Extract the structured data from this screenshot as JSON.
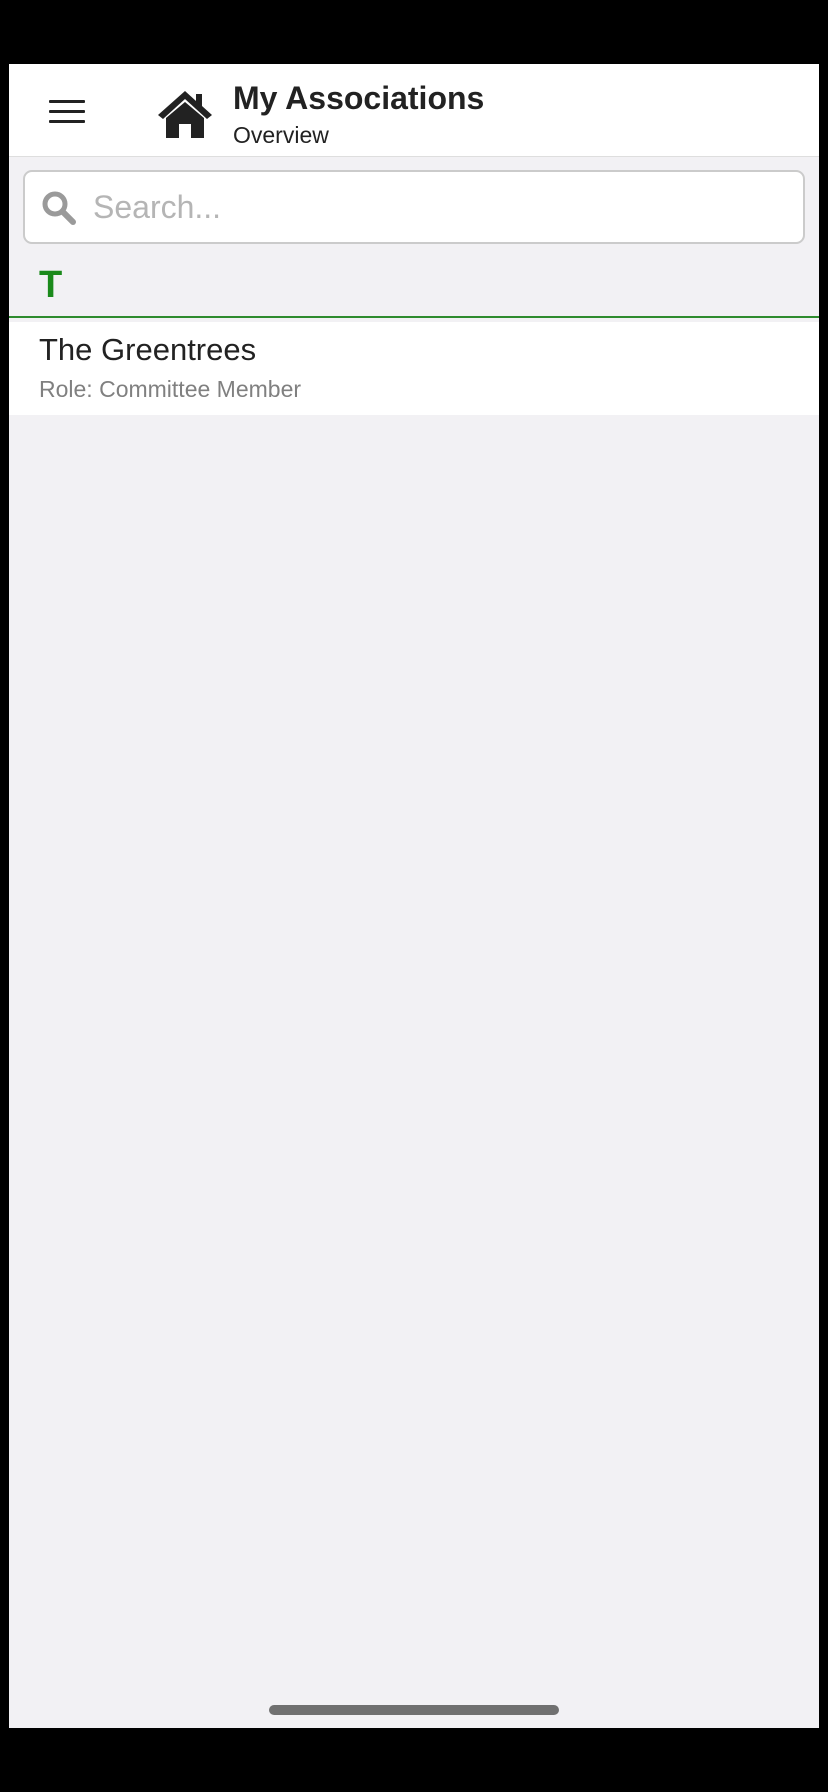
{
  "header": {
    "menu_icon": "hamburger-menu-icon",
    "home_icon": "home-icon",
    "title": "My Associations",
    "subtitle": "Overview"
  },
  "search": {
    "icon": "search-icon",
    "placeholder": "Search...",
    "value": ""
  },
  "sections": [
    {
      "letter": "T",
      "items": [
        {
          "title": "The Greentrees",
          "subtitle": "Role: Committee Member"
        }
      ]
    }
  ],
  "colors": {
    "accent": "#1b8a1b",
    "background": "#f2f1f4",
    "header_bg": "#ffffff",
    "text": "#222222",
    "secondary_text": "#808080"
  }
}
